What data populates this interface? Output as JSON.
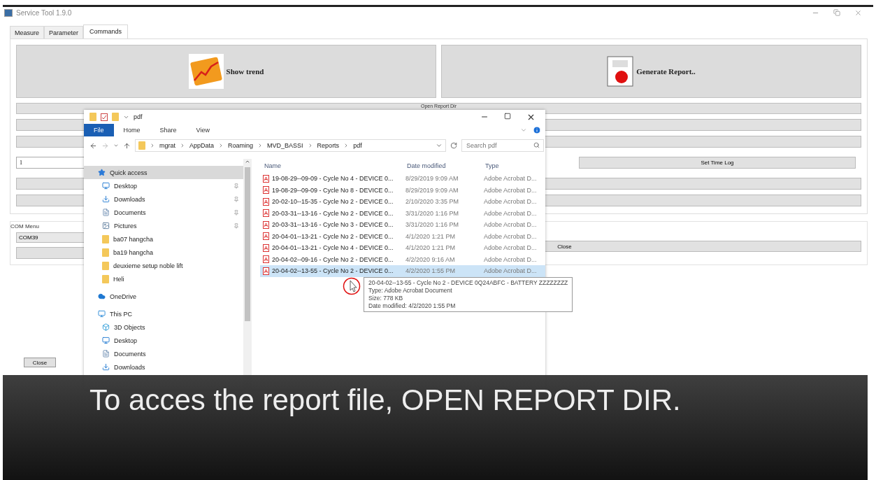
{
  "app": {
    "title": "Service Tool 1.9.0",
    "tabs": [
      {
        "label": "Measure",
        "selected": false
      },
      {
        "label": "Parameter",
        "selected": false
      },
      {
        "label": "Commands",
        "selected": true
      }
    ],
    "commands": {
      "show_trend": "Show trend",
      "generate_report": "Generate Report..",
      "open_report_dir": "Open Report Dir",
      "interval_value": "1",
      "set_time_log": "Set Time Log"
    },
    "com_menu": {
      "label": "COM Menu",
      "port": "COM39",
      "close": "Close"
    },
    "close": "Close"
  },
  "explorer": {
    "title": "pdf",
    "ribbon_tabs": [
      {
        "label": "File",
        "selected": true
      },
      {
        "label": "Home",
        "selected": false
      },
      {
        "label": "Share",
        "selected": false
      },
      {
        "label": "View",
        "selected": false
      }
    ],
    "path": [
      "mgrat",
      "AppData",
      "Roaming",
      "MVD_BASSI",
      "Reports",
      "pdf"
    ],
    "search": {
      "placeholder": "Search pdf"
    },
    "nav": [
      {
        "label": "Quick access",
        "kind": "star",
        "selected": true,
        "children": [
          {
            "label": "Desktop",
            "kind": "desktop",
            "selected": false,
            "pinned": true
          },
          {
            "label": "Downloads",
            "kind": "download",
            "selected": false,
            "pinned": true
          },
          {
            "label": "Documents",
            "kind": "document",
            "selected": false,
            "pinned": true
          },
          {
            "label": "Pictures",
            "kind": "picture",
            "selected": false,
            "pinned": true
          },
          {
            "label": "ba07 hangcha",
            "kind": "folder",
            "selected": false,
            "pinned": false
          },
          {
            "label": "ba19 hangcha",
            "kind": "folder",
            "selected": false,
            "pinned": false
          },
          {
            "label": "deuxieme setup noble lift",
            "kind": "folder",
            "selected": false,
            "pinned": false
          },
          {
            "label": "Heli",
            "kind": "folder",
            "selected": false,
            "pinned": false
          }
        ]
      },
      {
        "label": "OneDrive",
        "kind": "cloud",
        "selected": false
      },
      {
        "label": "This PC",
        "kind": "pc",
        "selected": false,
        "children": [
          {
            "label": "3D Objects",
            "kind": "cube",
            "selected": false
          },
          {
            "label": "Desktop",
            "kind": "desktop",
            "selected": false
          },
          {
            "label": "Documents",
            "kind": "document",
            "selected": false
          },
          {
            "label": "Downloads",
            "kind": "download",
            "selected": false
          }
        ]
      }
    ],
    "columns": [
      "Name",
      "Date modified",
      "Type"
    ],
    "files": [
      {
        "name": "19-08-29--09-09 - Cycle No 4 - DEVICE 0...",
        "date": "8/29/2019 9:09 AM",
        "type": "Adobe Acrobat D...",
        "selected": false
      },
      {
        "name": "19-08-29--09-09 - Cycle No 8 - DEVICE 0...",
        "date": "8/29/2019 9:09 AM",
        "type": "Adobe Acrobat D...",
        "selected": false
      },
      {
        "name": "20-02-10--15-35 - Cycle No 2 - DEVICE 0...",
        "date": "2/10/2020 3:35 PM",
        "type": "Adobe Acrobat D...",
        "selected": false
      },
      {
        "name": "20-03-31--13-16 - Cycle No 2 - DEVICE 0...",
        "date": "3/31/2020 1:16 PM",
        "type": "Adobe Acrobat D...",
        "selected": false
      },
      {
        "name": "20-03-31--13-16 - Cycle No 3 - DEVICE 0...",
        "date": "3/31/2020 1:16 PM",
        "type": "Adobe Acrobat D...",
        "selected": false
      },
      {
        "name": "20-04-01--13-21 - Cycle No 2 - DEVICE 0...",
        "date": "4/1/2020 1:21 PM",
        "type": "Adobe Acrobat D...",
        "selected": false
      },
      {
        "name": "20-04-01--13-21 - Cycle No 4 - DEVICE 0...",
        "date": "4/1/2020 1:21 PM",
        "type": "Adobe Acrobat D...",
        "selected": false
      },
      {
        "name": "20-04-02--09-16 - Cycle No 2 - DEVICE 0...",
        "date": "4/2/2020 9:16 AM",
        "type": "Adobe Acrobat D...",
        "selected": false
      },
      {
        "name": "20-04-02--13-55 - Cycle No 2 - DEVICE 0...",
        "date": "4/2/2020 1:55 PM",
        "type": "Adobe Acrobat D...",
        "selected": true
      }
    ],
    "tooltip": [
      "20-04-02--13-55 - Cycle No 2 - DEVICE 0Q24ABFC - BATTERY ZZZZZZZZ",
      "Type: Adobe Acrobat Document",
      "Size: 778 KB",
      "Date modified: 4/2/2020 1:55 PM"
    ]
  },
  "caption": "To acces the report file, OPEN REPORT DIR."
}
